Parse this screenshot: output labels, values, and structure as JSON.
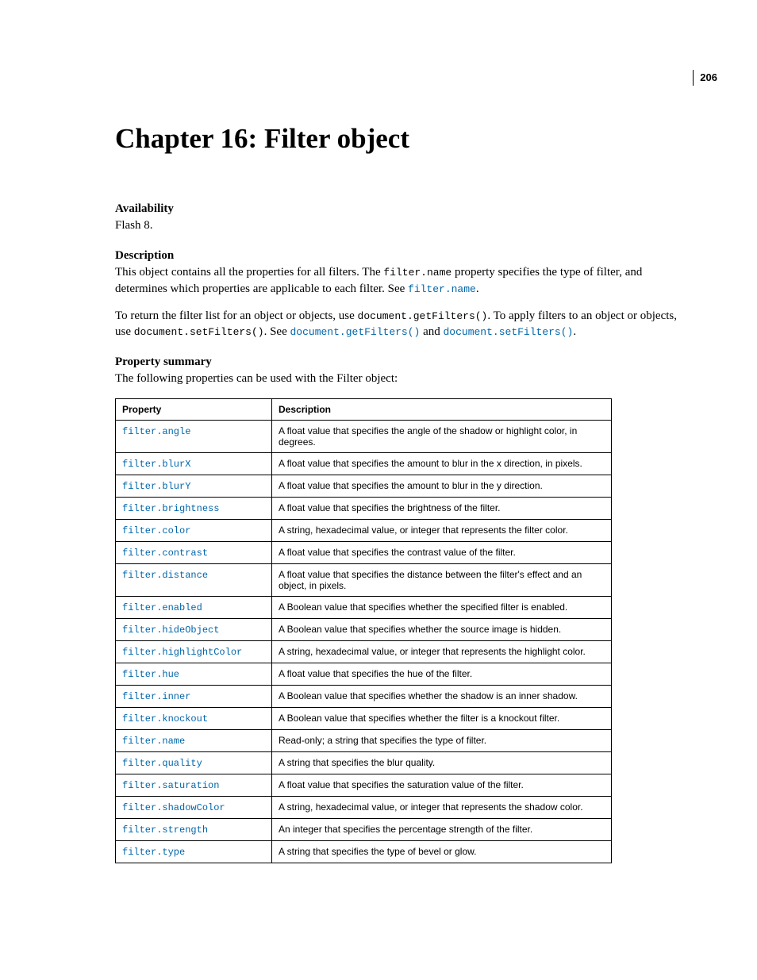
{
  "page_number": "206",
  "chapter_title": "Chapter 16: Filter object",
  "section_availability": {
    "heading": "Availability",
    "text": "Flash 8."
  },
  "section_description": {
    "heading": "Description",
    "para1_pre": "This object contains all the properties for all filters. The ",
    "para1_code1": "filter.name",
    "para1_mid": " property specifies the type of filter, and determines which properties are applicable to each filter. See ",
    "para1_link1": "filter.name",
    "para1_post": ".",
    "para2_pre": "To return the filter list for an object or objects, use ",
    "para2_code1": "document.getFilters()",
    "para2_mid1": ". To apply filters to an object or objects, use ",
    "para2_code2": "document.setFilters()",
    "para2_mid2": ". See ",
    "para2_link1": "document.getFilters()",
    "para2_and": " and ",
    "para2_link2": "document.setFilters()",
    "para2_post": "."
  },
  "section_property_summary": {
    "heading": "Property summary",
    "intro": "The following properties can be used with the Filter object:",
    "table": {
      "col1": "Property",
      "col2": "Description",
      "rows": [
        {
          "prop": "filter.angle",
          "desc": "A float value that specifies the angle of the shadow or highlight color, in degrees."
        },
        {
          "prop": "filter.blurX",
          "desc": "A float value that specifies the amount to blur in the x direction, in pixels."
        },
        {
          "prop": "filter.blurY",
          "desc": "A float value that specifies the amount to blur in the y direction."
        },
        {
          "prop": "filter.brightness",
          "desc": "A float value that specifies the brightness of the filter."
        },
        {
          "prop": "filter.color",
          "desc": "A string, hexadecimal value, or integer that represents the filter color."
        },
        {
          "prop": "filter.contrast",
          "desc": "A float value that specifies the contrast value of the filter."
        },
        {
          "prop": "filter.distance",
          "desc": "A float value that specifies the distance between the filter's effect and an object, in pixels."
        },
        {
          "prop": "filter.enabled",
          "desc": "A Boolean value that specifies whether the specified filter is enabled."
        },
        {
          "prop": "filter.hideObject",
          "desc": "A Boolean value that specifies whether the source image is hidden."
        },
        {
          "prop": "filter.highlightColor",
          "desc": "A string, hexadecimal value, or integer that represents the highlight color."
        },
        {
          "prop": "filter.hue",
          "desc": "A float value that specifies the hue of the filter."
        },
        {
          "prop": "filter.inner",
          "desc": "A Boolean value that specifies whether the shadow is an inner shadow."
        },
        {
          "prop": "filter.knockout",
          "desc": "A Boolean value that specifies whether the filter is a knockout filter."
        },
        {
          "prop": "filter.name",
          "desc": "Read-only; a string that specifies the type of filter."
        },
        {
          "prop": "filter.quality",
          "desc": "A string that specifies the blur quality."
        },
        {
          "prop": "filter.saturation",
          "desc": "A float value that specifies the saturation value of the filter."
        },
        {
          "prop": "filter.shadowColor",
          "desc": "A string, hexadecimal value, or integer that represents the shadow color."
        },
        {
          "prop": "filter.strength",
          "desc": "An integer that specifies the percentage strength of the filter."
        },
        {
          "prop": "filter.type",
          "desc": "A string that specifies the type of bevel or glow."
        }
      ]
    }
  }
}
